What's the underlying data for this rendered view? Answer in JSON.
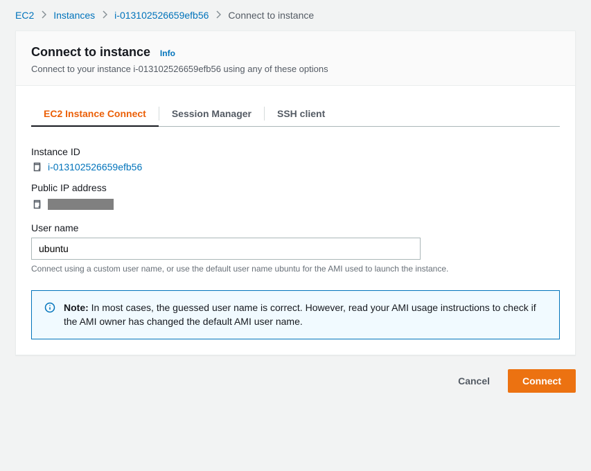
{
  "breadcrumb": {
    "root": "EC2",
    "level1": "Instances",
    "instance_id": "i-013102526659efb56",
    "current": "Connect to instance"
  },
  "header": {
    "title": "Connect to instance",
    "info": "Info",
    "subtitle": "Connect to your instance i-013102526659efb56 using any of these options"
  },
  "tabs": {
    "ec2_connect": "EC2 Instance Connect",
    "session_manager": "Session Manager",
    "ssh_client": "SSH client"
  },
  "fields": {
    "instance_id_label": "Instance ID",
    "instance_id_value": "i-013102526659efb56",
    "public_ip_label": "Public IP address",
    "username_label": "User name",
    "username_value": "ubuntu",
    "username_help": "Connect using a custom user name, or use the default user name ubuntu for the AMI used to launch the instance."
  },
  "note": {
    "bold": "Note:",
    "text": " In most cases, the guessed user name is correct. However, read your AMI usage instructions to check if the AMI owner has changed the default AMI user name."
  },
  "actions": {
    "cancel": "Cancel",
    "connect": "Connect"
  }
}
